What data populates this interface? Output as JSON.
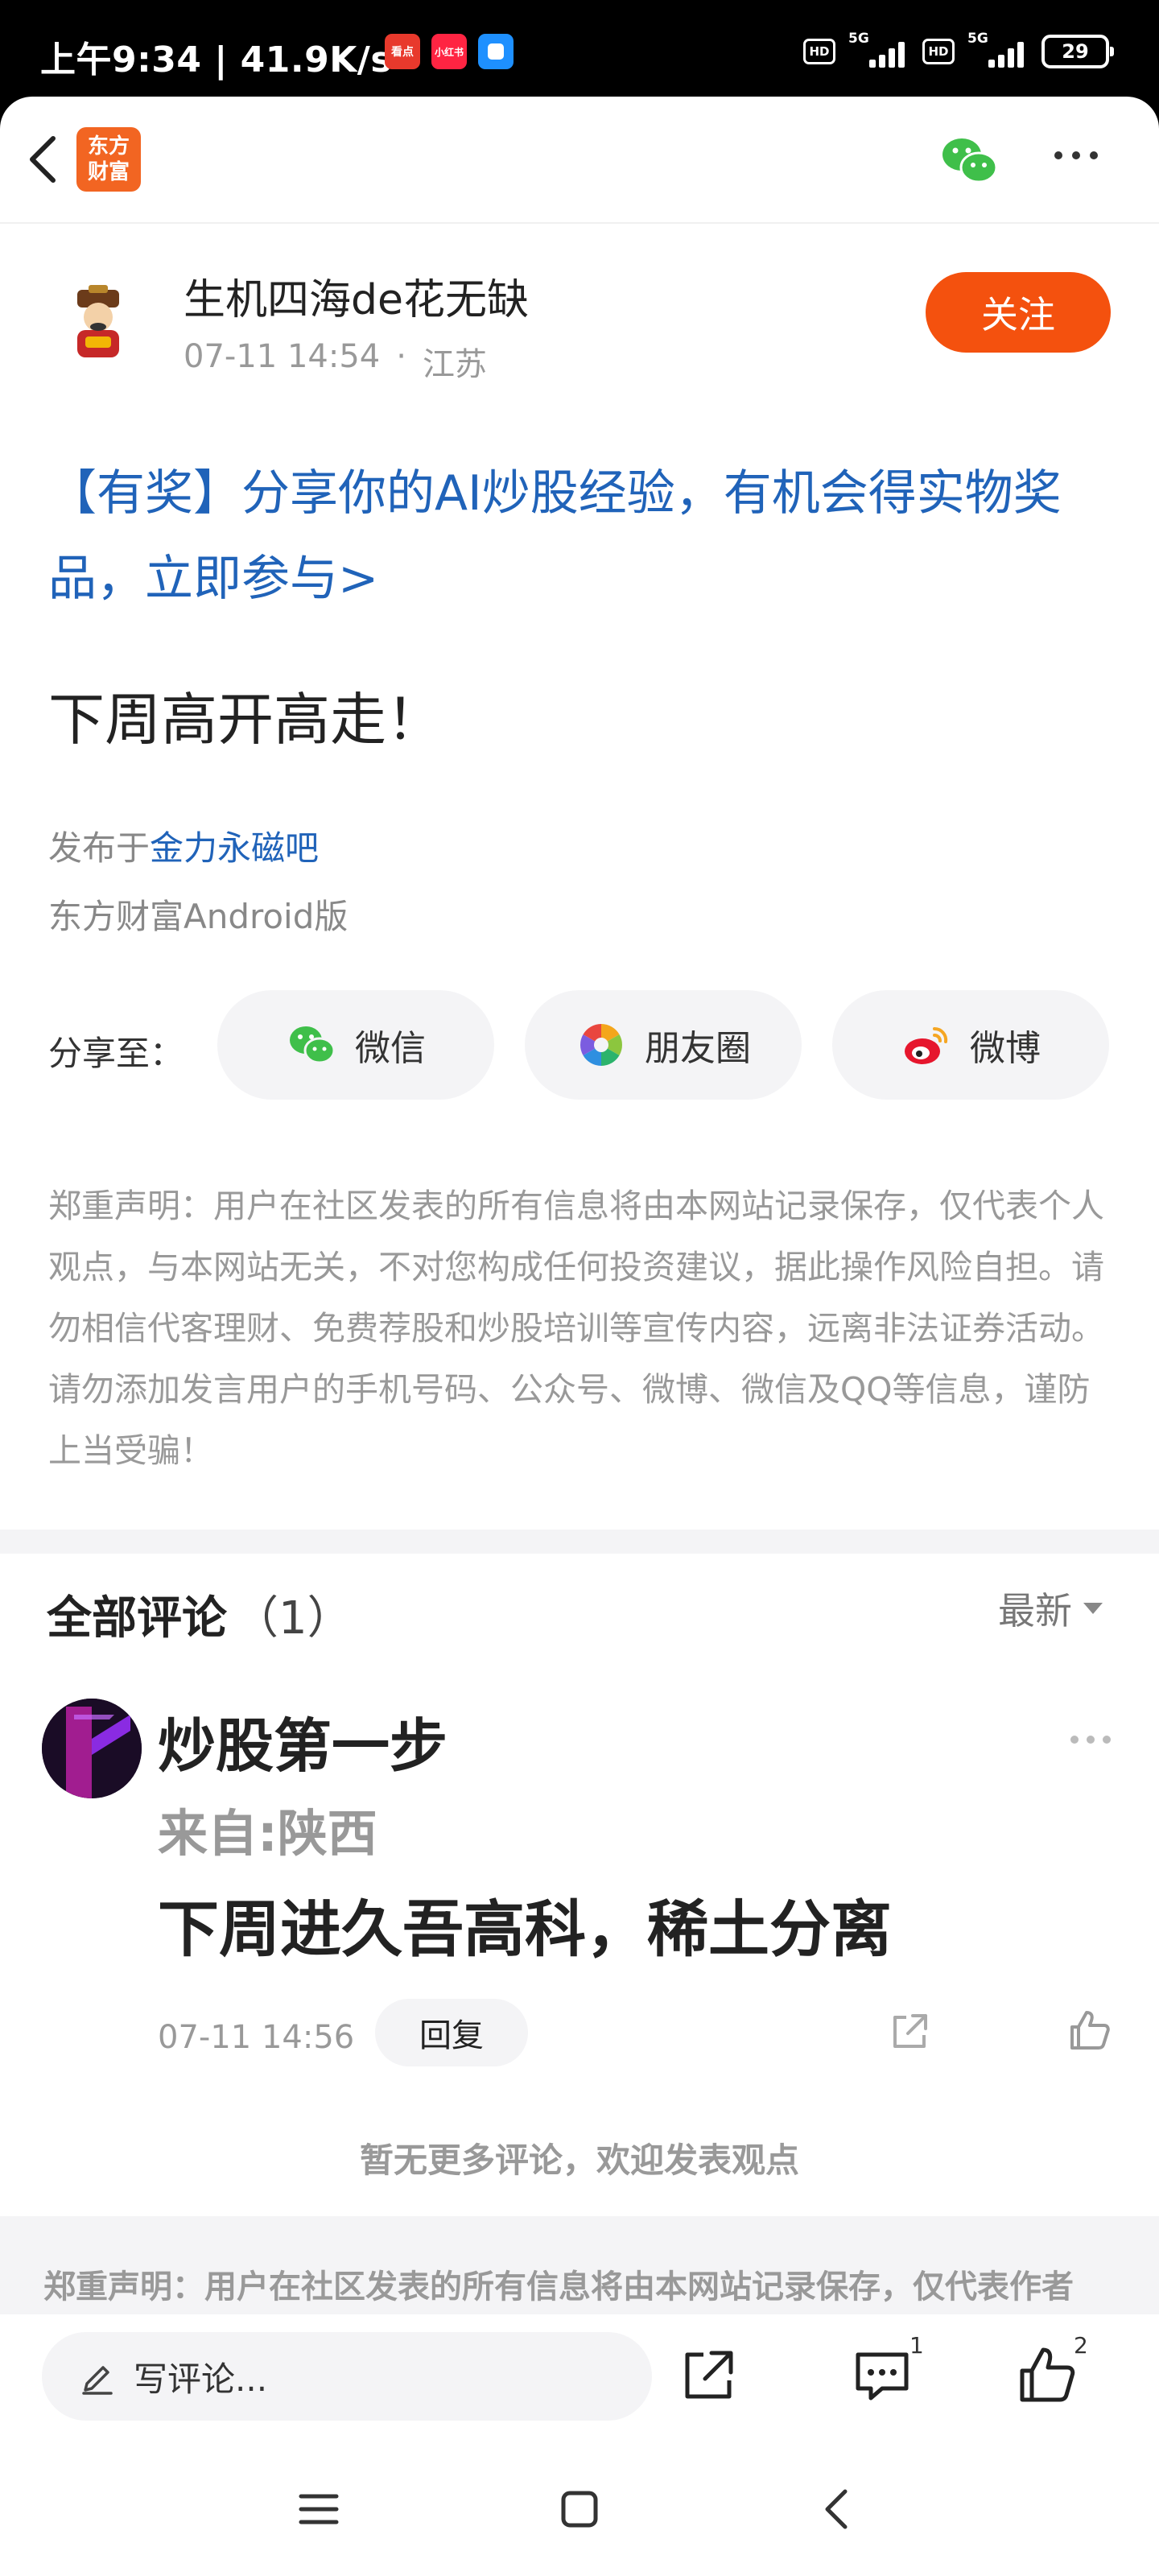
{
  "status_bar": {
    "time": "上午9:34 | 41.9K/s",
    "app_icons": [
      {
        "name": "news-app-icon",
        "label": "看点",
        "color": "#e8392c"
      },
      {
        "name": "xiaohongshu-app-icon",
        "label": "小红书",
        "color": "#ff2442"
      },
      {
        "name": "blue-app-icon",
        "label": "",
        "color": "#1e90ff"
      }
    ],
    "hd_label": "HD",
    "network_label": "5G",
    "battery": "29"
  },
  "nav": {
    "logo_line1": "东方",
    "logo_line2": "财富",
    "brand_color": "#f26522"
  },
  "author": {
    "name": "生机四海de花无缺",
    "time": "07-11 14:54",
    "separator": "·",
    "location": "江苏",
    "follow_label": "关注"
  },
  "post": {
    "promo_text": "【有奖】分享你的AI炒股经验，有机会得实物奖品，立即参与>",
    "title": "下周高开高走！",
    "source_prefix": "发布于",
    "source_bar": "金力永磁吧",
    "client": "东方财富Android版"
  },
  "share": {
    "label": "分享至：",
    "targets": [
      {
        "label": "微信",
        "icon": "wechat-icon"
      },
      {
        "label": "朋友圈",
        "icon": "moments-icon"
      },
      {
        "label": "微博",
        "icon": "weibo-icon"
      }
    ]
  },
  "disclaimer": "郑重声明：用户在社区发表的所有信息将由本网站记录保存，仅代表个人观点，与本网站无关，不对您构成任何投资建议，据此操作风险自担。请勿相信代客理财、免费荐股和炒股培训等宣传内容，远离非法证券活动。请勿添加发言用户的手机号码、公众号、微博、微信及QQ等信息，谨防上当受骗！",
  "comments": {
    "title": "全部评论",
    "count": "（1）",
    "sort_label": "最新",
    "items": [
      {
        "user": "炒股第一步",
        "from": "来自:陕西",
        "text": "下周进久吾高科，稀土分离",
        "time": "07-11 14:56",
        "reply_label": "回复"
      }
    ],
    "no_more": "暂无更多评论，欢迎发表观点"
  },
  "footer_disclaimer": "郑重声明：用户在社区发表的所有信息将由本网站记录保存，仅代表作者",
  "bottom_bar": {
    "write_placeholder": "写评论...",
    "comment_count": "1",
    "like_count": "2"
  },
  "colors": {
    "link_blue": "#2063b9",
    "follow_orange": "#f4510e",
    "muted_gray": "#999999"
  }
}
